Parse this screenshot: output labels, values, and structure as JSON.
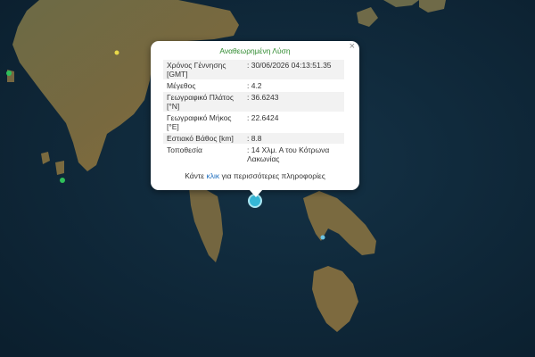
{
  "popup": {
    "title": "Αναθεωρημένη Λύση",
    "close_label": "×",
    "rows": [
      {
        "key": "Χρόνος Γέννησης\n[GMT]",
        "value": ": 30/06/2026 04:13:51.35"
      },
      {
        "key": "Μέγεθος",
        "value": ": 4.2"
      },
      {
        "key": "Γεωγραφικό Πλάτος\n[°N]",
        "value": ": 36.6243"
      },
      {
        "key": "Γεωγραφικό Μήκος\n[°E]",
        "value": ": 22.6424"
      },
      {
        "key": "Εστιακό Βάθος [km]",
        "value": ": 8.8"
      },
      {
        "key": "Τοποθεσία",
        "value": ": 14 Χλμ. Α του Κότρωνα\nΛακωνίας"
      }
    ],
    "footer_before": "Κάντε ",
    "footer_link": "κλικ",
    "footer_after": " για περισσότερες πληροφορίες"
  },
  "map": {
    "sea_color": "#0f2738",
    "land_color": "#6e6642",
    "marker_color": "#35b7d6",
    "small_marker_color": "#2fbf5a"
  }
}
